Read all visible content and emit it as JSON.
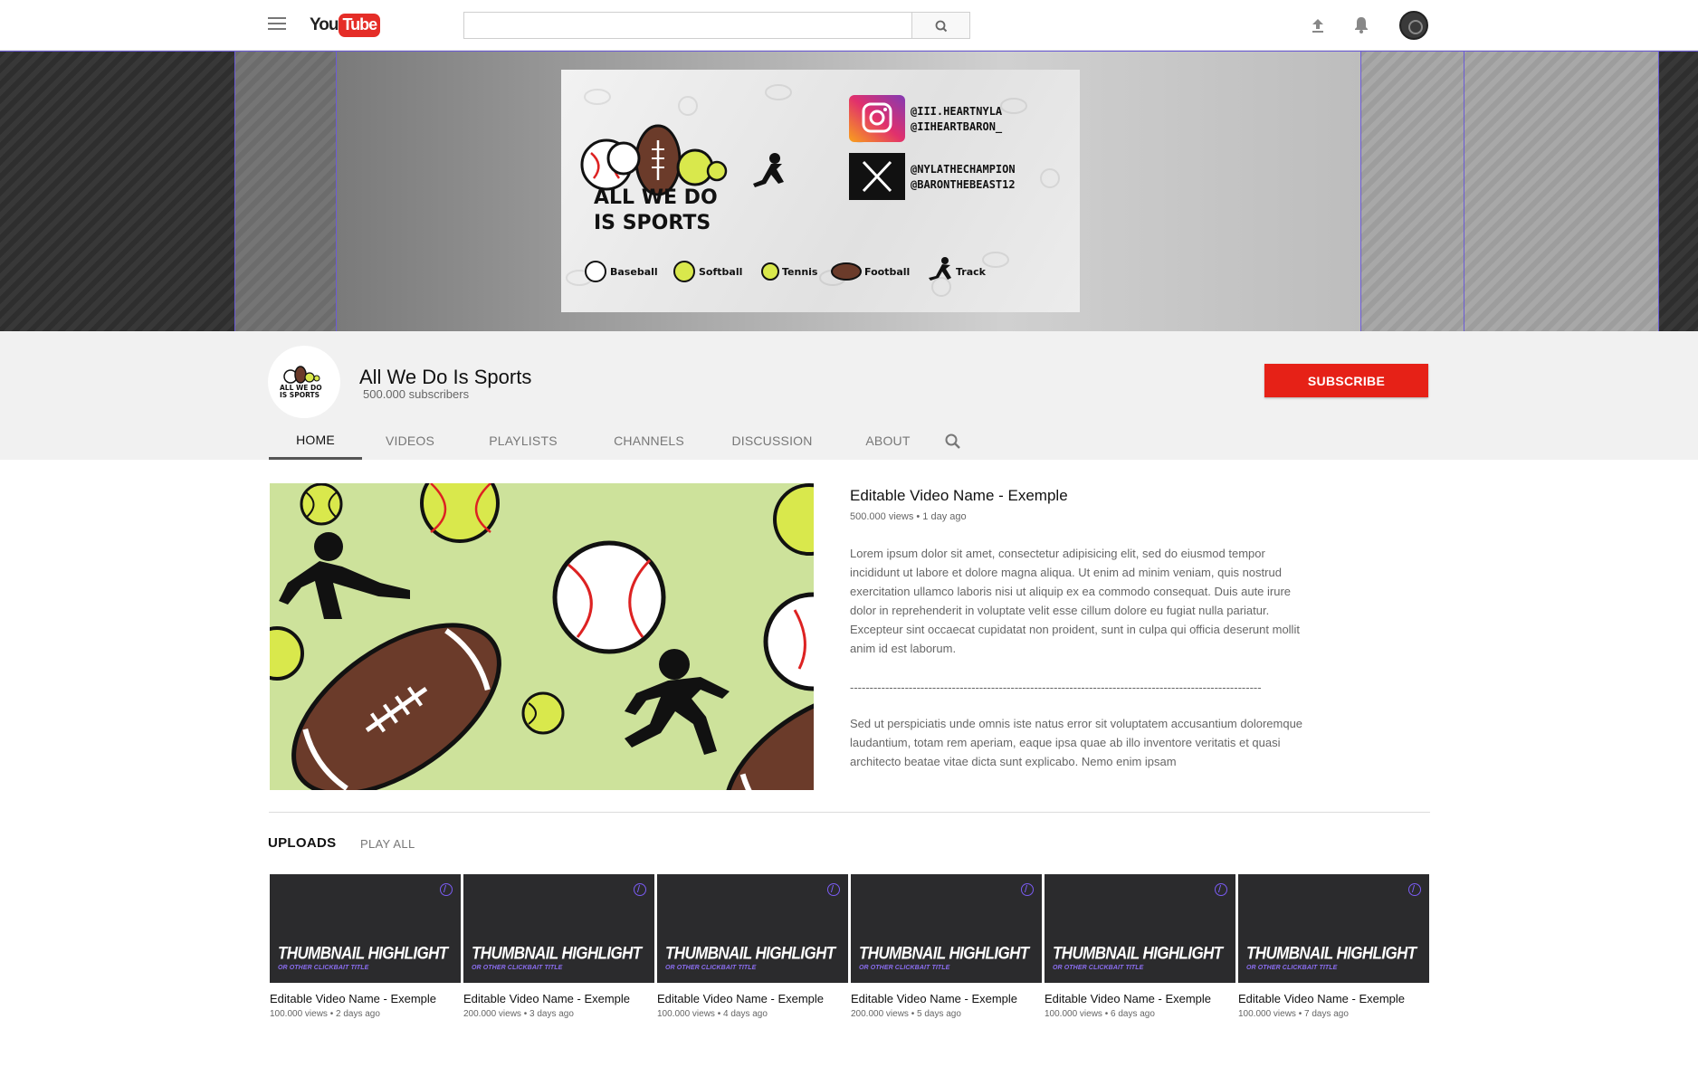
{
  "topbar": {
    "logo_you": "You",
    "logo_tube": "Tube",
    "search_placeholder": "",
    "icons": [
      "menu-icon",
      "search-icon",
      "upload-icon",
      "bell-icon",
      "avatar"
    ]
  },
  "banner": {
    "art_title_line1": "ALL WE DO",
    "art_title_line2": "IS SPORTS",
    "instagram_handles": [
      "@III.HEARTNYLA",
      "@IIHEARTBARON_"
    ],
    "x_handles": [
      "@NYLATHECHAMPION",
      "@BARONTHEBEAST12"
    ],
    "sports": [
      "Baseball",
      "Softball",
      "Tennis",
      "Football",
      "Track"
    ]
  },
  "channel": {
    "name": "All We Do Is Sports",
    "subscribers": "500.000 subscribers",
    "avatar_text_line1": "ALL WE DO",
    "avatar_text_line2": "IS SPORTS",
    "subscribe_label": "SUBSCRIBE",
    "tabs": [
      "HOME",
      "VIDEOS",
      "PLAYLISTS",
      "CHANNELS",
      "DISCUSSION",
      "ABOUT"
    ],
    "active_tab": "HOME"
  },
  "featured": {
    "title": "Editable Video Name - Exemple",
    "meta": "500.000 views • 1 day ago",
    "description": "Lorem ipsum dolor sit amet, consectetur adipisicing elit, sed do eiusmod tempor incididunt ut labore et dolore magna aliqua. Ut enim ad minim veniam, quis nostrud exercitation ullamco laboris nisi ut aliquip ex ea commodo consequat. Duis aute irure dolor in reprehenderit in voluptate velit esse cillum dolore eu fugiat nulla pariatur. Excepteur sint occaecat cupidatat non proident, sunt in culpa qui officia deserunt mollit anim id est laborum.",
    "divider": "---------------------------------------------------------------------------------------------------------",
    "description2": "Sed ut perspiciatis unde omnis iste natus error sit voluptatem accusantium doloremque laudantium, totam rem aperiam, eaque ipsa quae ab illo inventore veritatis et quasi architecto beatae vitae dicta sunt explicabo. Nemo enim ipsam"
  },
  "uploads": {
    "title": "UPLOADS",
    "play_all": "PLAY ALL",
    "videos": [
      {
        "highlight": "THUMBNAIL HIGHLIGHT",
        "sub": "OR OTHER CLICKBAIT TITLE",
        "title": "Editable Video Name - Exemple",
        "meta": "100.000 views • 2 days ago"
      },
      {
        "highlight": "THUMBNAIL HIGHLIGHT",
        "sub": "OR OTHER CLICKBAIT TITLE",
        "title": "Editable Video Name - Exemple",
        "meta": "200.000 views • 3 days ago"
      },
      {
        "highlight": "THUMBNAIL HIGHLIGHT",
        "sub": "OR OTHER CLICKBAIT TITLE",
        "title": "Editable Video Name - Exemple",
        "meta": "100.000 views • 4 days ago"
      },
      {
        "highlight": "THUMBNAIL HIGHLIGHT",
        "sub": "OR OTHER CLICKBAIT TITLE",
        "title": "Editable Video Name - Exemple",
        "meta": "200.000 views • 5 days ago"
      },
      {
        "highlight": "THUMBNAIL HIGHLIGHT",
        "sub": "OR OTHER CLICKBAIT TITLE",
        "title": "Editable Video Name - Exemple",
        "meta": "100.000 views • 6 days ago"
      },
      {
        "highlight": "THUMBNAIL HIGHLIGHT",
        "sub": "OR OTHER CLICKBAIT TITLE",
        "title": "Editable Video Name - Exemple",
        "meta": "100.000 views • 7 days ago"
      }
    ]
  },
  "colors": {
    "subscribe_red": "#e62117",
    "guide_lines": "#6b5bd6",
    "thumb_bg": "#2b2b2d",
    "thumb_accent": "#7b5cf5",
    "featured_bg": "#cde29b"
  }
}
